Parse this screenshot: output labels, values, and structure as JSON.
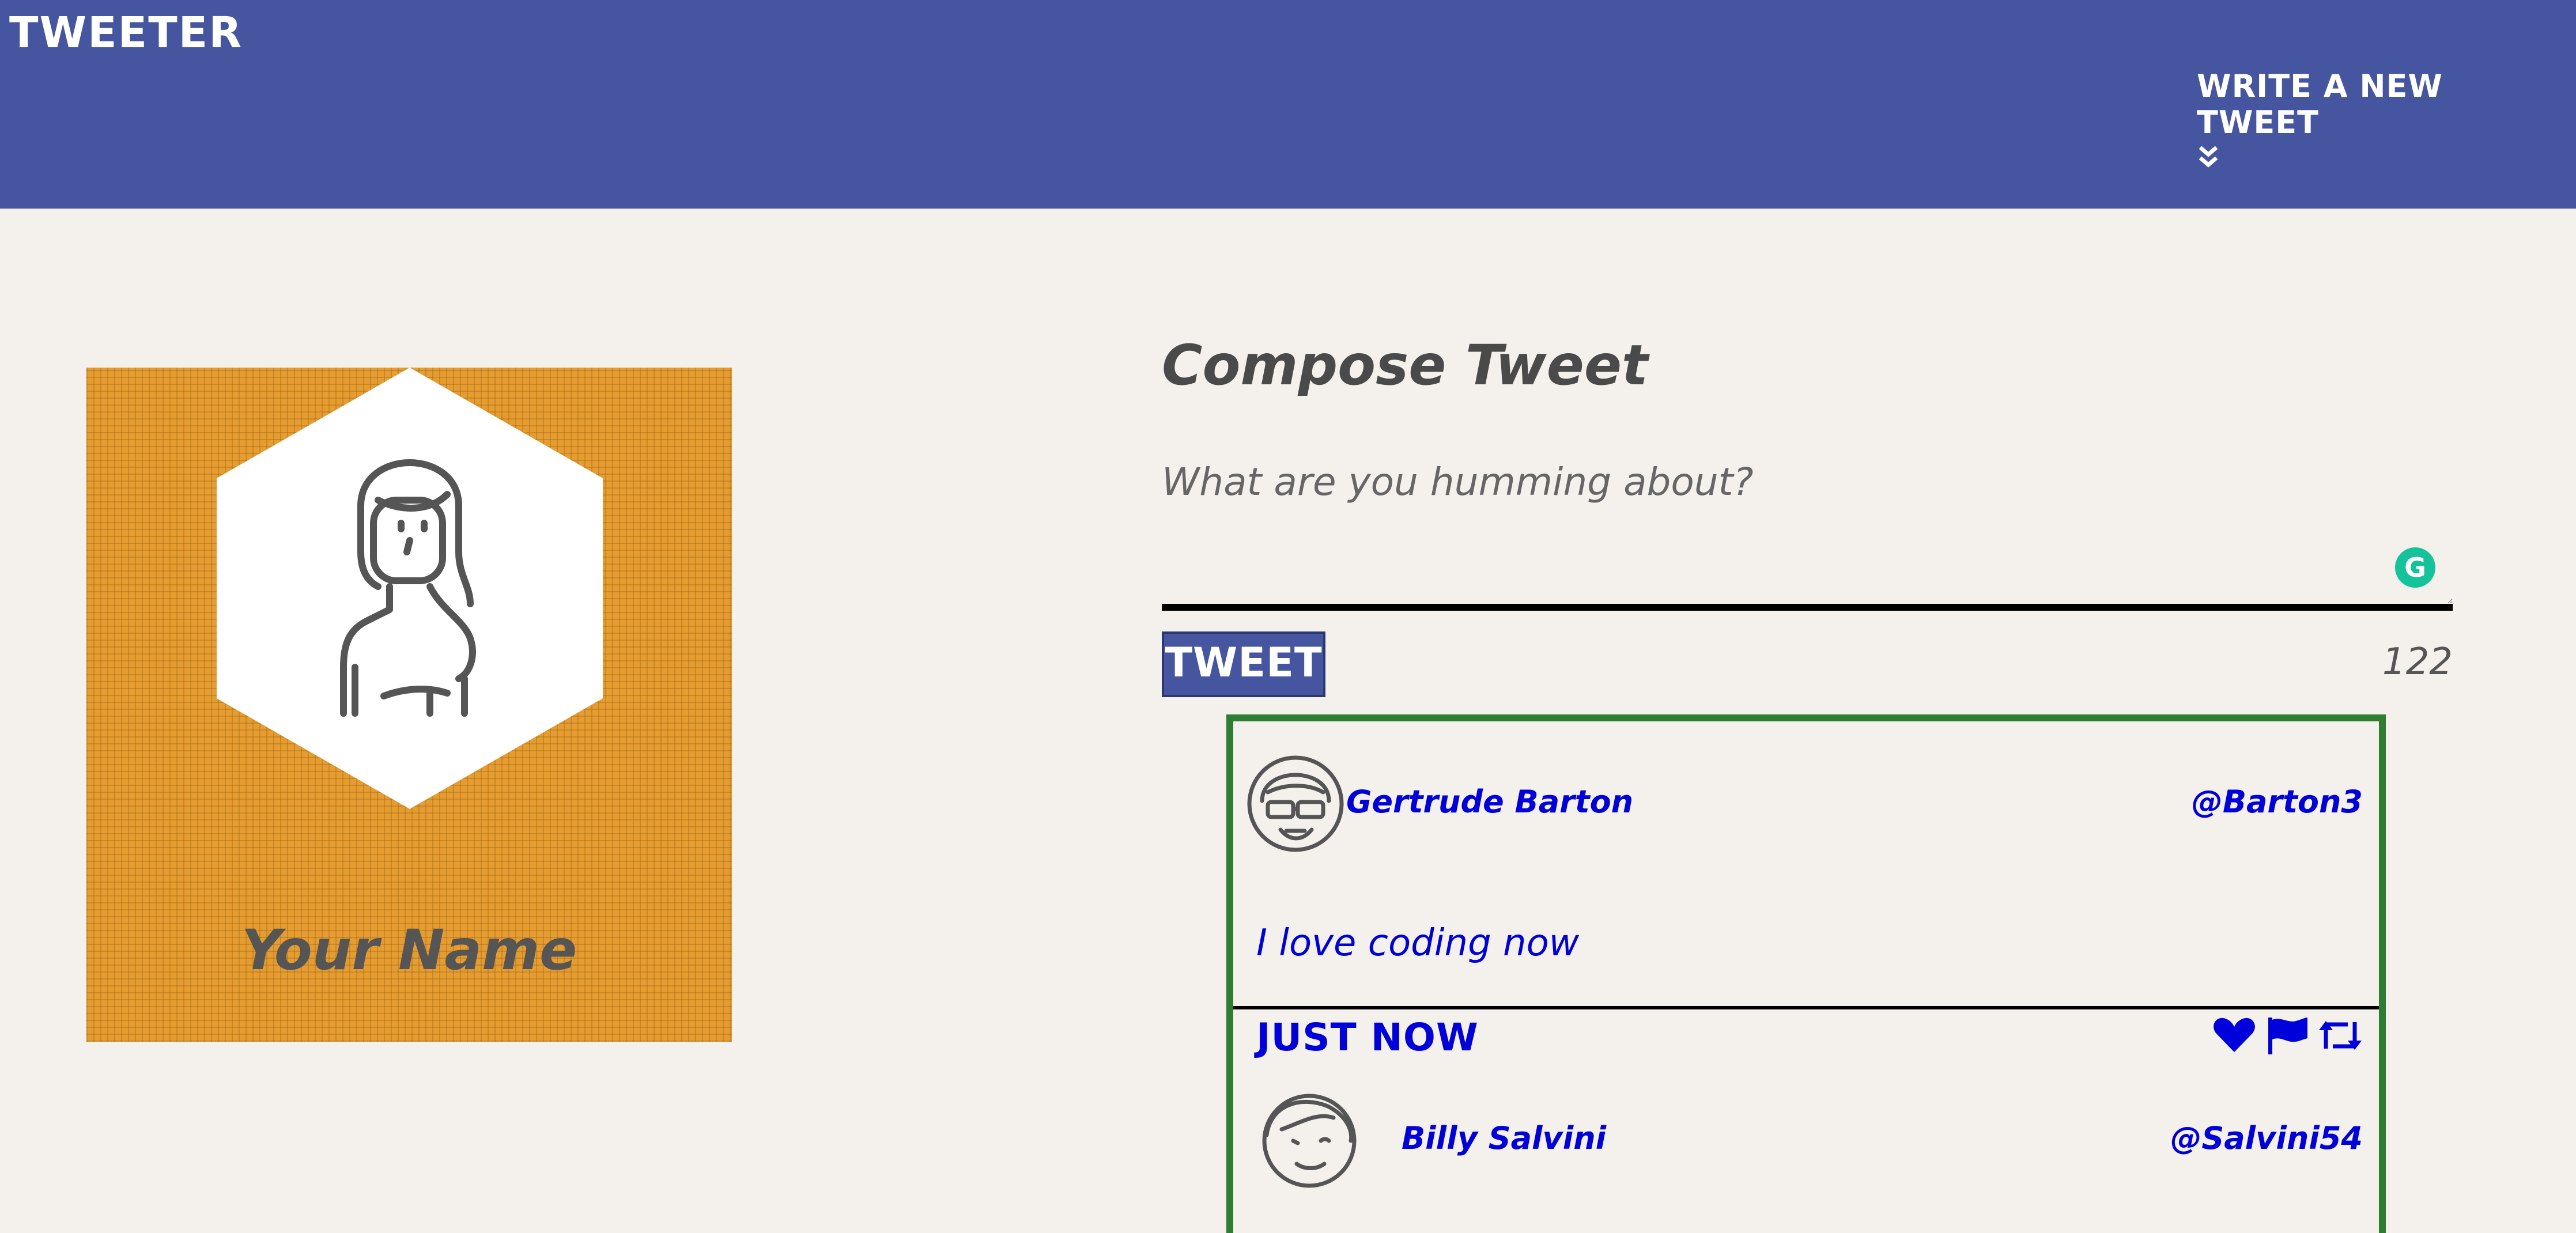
{
  "nav": {
    "brand": "TWEETER",
    "write_link": "WRITE A NEW TWEET"
  },
  "profile": {
    "name": "Your Name"
  },
  "compose": {
    "title": "Compose Tweet",
    "placeholder": "What are you humming about?",
    "button_label": "TWEET",
    "char_counter": "122"
  },
  "tweets": [
    {
      "name": "Gertrude Barton",
      "handle": "@Barton3",
      "content": "I love coding now",
      "time": "JUST NOW"
    },
    {
      "name": "Billy Salvini",
      "handle": "@Salvini54"
    }
  ],
  "colors": {
    "nav_bg": "#4555a0",
    "page_bg": "#f4f1ed",
    "profile_bg": "#e69c2f",
    "tweet_text": "#0000dd",
    "tweet_border": "#2e7d32"
  },
  "icons": {
    "nav": "double-chevron-down-icon",
    "actions": [
      "heart-icon",
      "flag-icon",
      "retweet-icon"
    ]
  }
}
